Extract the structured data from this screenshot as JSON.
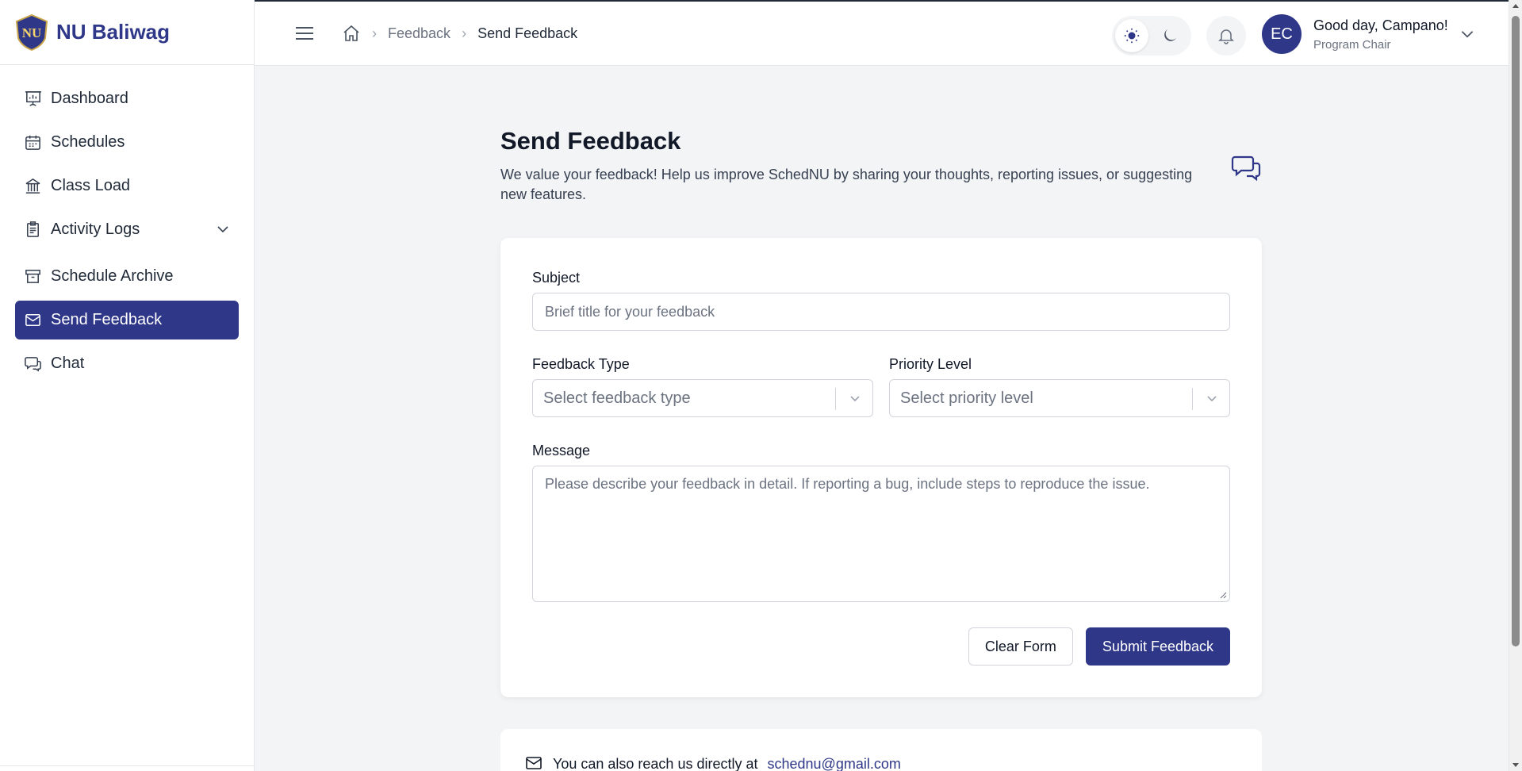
{
  "brand": {
    "name": "NU Baliwag",
    "logo_text": "NU"
  },
  "sidebar": {
    "items": [
      {
        "label": "Dashboard",
        "icon": "dashboard-icon"
      },
      {
        "label": "Schedules",
        "icon": "calendar-icon"
      },
      {
        "label": "Class Load",
        "icon": "building-icon"
      },
      {
        "label": "Activity Logs",
        "icon": "clipboard-icon"
      },
      {
        "label": "Schedule Archive",
        "icon": "archive-icon"
      },
      {
        "label": "Send Feedback",
        "icon": "mail-icon"
      },
      {
        "label": "Chat",
        "icon": "chat-icon"
      }
    ]
  },
  "header": {
    "breadcrumb": {
      "parent": "Feedback",
      "current": "Send Feedback"
    },
    "user": {
      "initials": "EC",
      "greeting": "Good day, Campano!",
      "role": "Program Chair"
    }
  },
  "main": {
    "title": "Send Feedback",
    "description": "We value your feedback! Help us improve SchedNU by sharing your thoughts, reporting issues, or suggesting new features.",
    "form": {
      "subject_label": "Subject",
      "subject_placeholder": "Brief title for your feedback",
      "type_label": "Feedback Type",
      "type_placeholder": "Select feedback type",
      "priority_label": "Priority Level",
      "priority_placeholder": "Select priority level",
      "message_label": "Message",
      "message_placeholder": "Please describe your feedback in detail. If reporting a bug, include steps to reproduce the issue.",
      "clear_label": "Clear Form",
      "submit_label": "Submit Feedback"
    },
    "contact": {
      "text": "You can also reach us directly at",
      "email": "schednu@gmail.com"
    }
  },
  "colors": {
    "primary": "#2e3788",
    "background": "#f3f4f6"
  }
}
